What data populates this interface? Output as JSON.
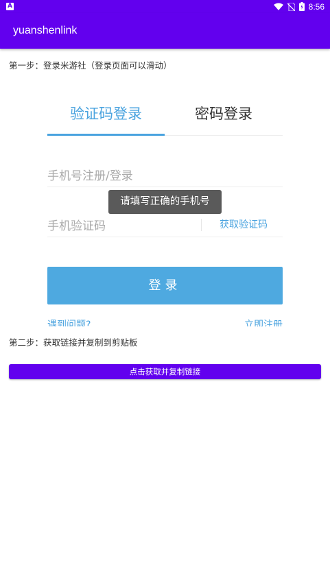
{
  "status_bar": {
    "time": "8:56",
    "notification_letter": "A"
  },
  "app_bar": {
    "title": "yuanshenlink"
  },
  "step1": {
    "text": "第一步：登录米游社（登录页面可以滑动）"
  },
  "login": {
    "tabs": [
      {
        "label": "验证码登录",
        "active": true
      },
      {
        "label": "密码登录",
        "active": false
      }
    ],
    "phone_placeholder": "手机号注册/登录",
    "code_placeholder": "手机验证码",
    "get_code_label": "获取验证码",
    "login_button": "登录",
    "problem_link": "遇到问题?",
    "register_link": "立即注册"
  },
  "toast": {
    "text": "请填写正确的手机号"
  },
  "step2": {
    "text": "第二步：获取链接并复制到剪贴板"
  },
  "copy_button": {
    "label": "点击获取并复制链接"
  },
  "colors": {
    "primary": "#6200EE",
    "accent_blue": "#4aa3df",
    "button_blue": "#4ea9e0",
    "toast_bg": "#5a5a5a"
  }
}
